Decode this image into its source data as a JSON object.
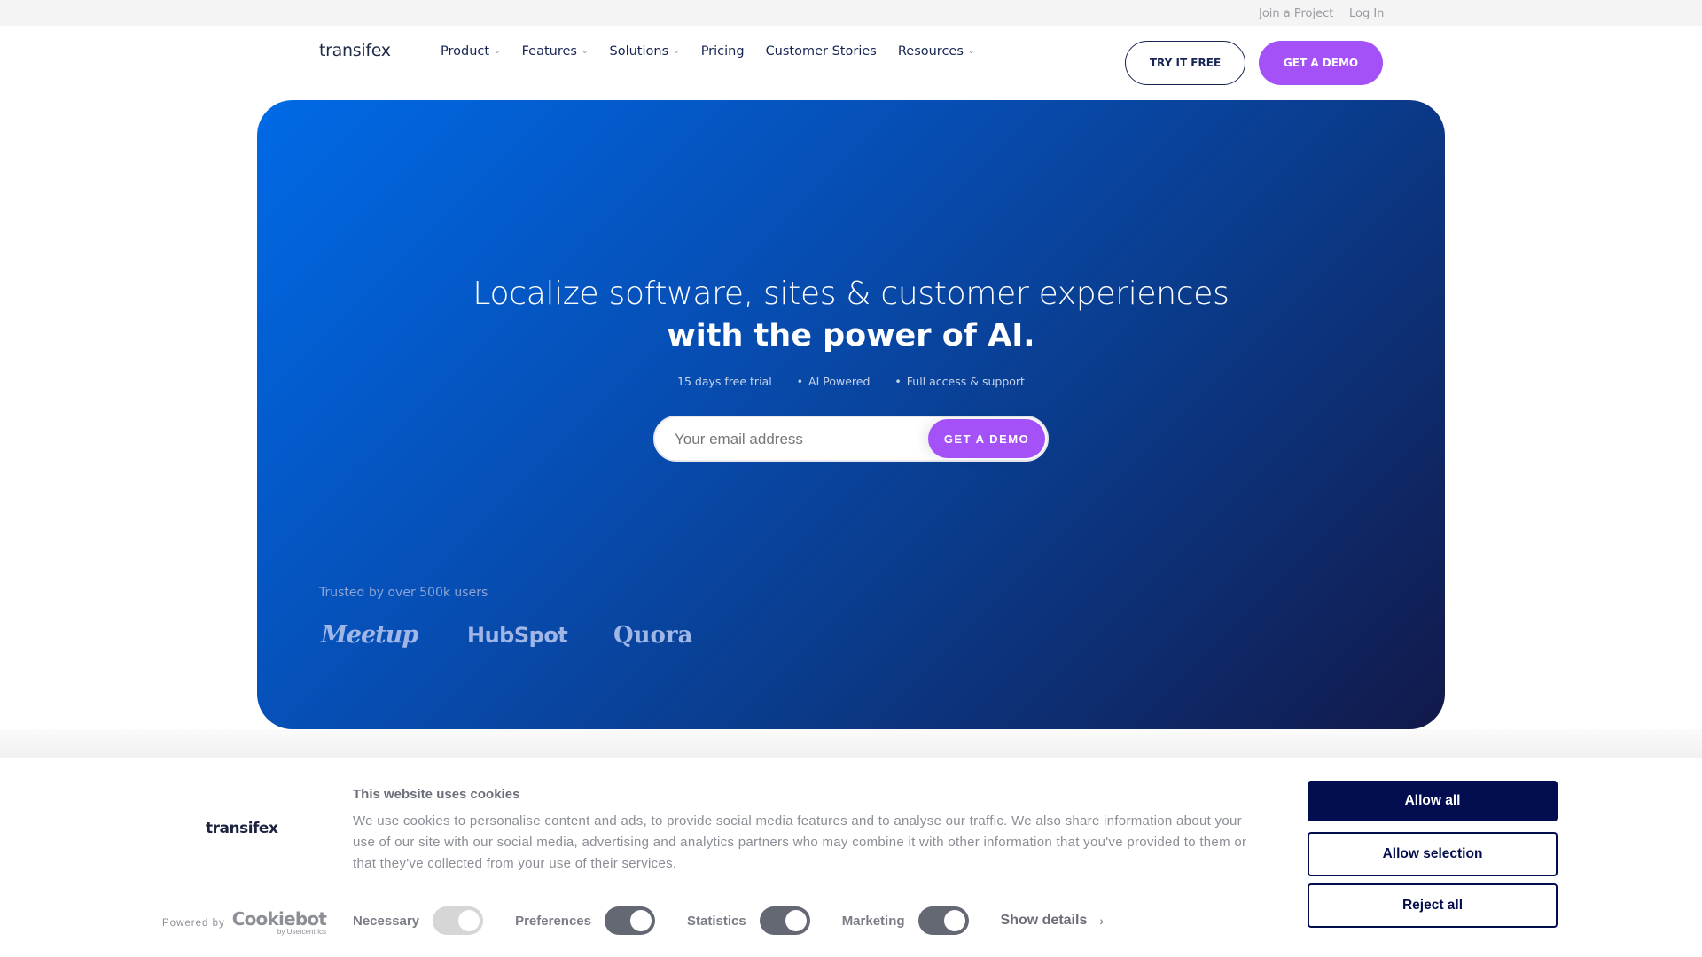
{
  "topbar": {
    "join_project": "Join a Project",
    "log_in": "Log In"
  },
  "nav": {
    "logo": "transifex",
    "items": [
      {
        "label": "Product",
        "has_dropdown": true
      },
      {
        "label": "Features",
        "has_dropdown": true
      },
      {
        "label": "Solutions",
        "has_dropdown": true
      },
      {
        "label": "Pricing",
        "has_dropdown": false
      },
      {
        "label": "Customer Stories",
        "has_dropdown": false
      },
      {
        "label": "Resources",
        "has_dropdown": true
      }
    ],
    "chevron": "⌄",
    "try_free": "TRY IT FREE",
    "get_demo": "GET A DEMO"
  },
  "hero": {
    "headline": "Localize software, sites & customer experiences",
    "headline_bold": "with the power of AI.",
    "bullets": [
      "15 days free trial",
      "AI Powered",
      "Full access & support"
    ],
    "bullet_dot": "•",
    "email_placeholder": "Your email address",
    "email_value": "",
    "cta": "GET A DEMO",
    "trusted": "Trusted by over 500k users",
    "customer_logos": [
      "Meetup",
      "HubSpot",
      "Quora"
    ]
  },
  "cookie": {
    "logo": "transifex",
    "powered_by": "Powered by",
    "cookiebot": "Cookiebot",
    "usercentrics": "by Usercentrics",
    "title": "This website uses cookies",
    "text": "We use cookies to personalise content and ads, to provide social media features and to analyse our traffic. We also share information about your use of our site with our social media, advertising and analytics partners who may combine it with other information that you've provided to them or that they've collected from your use of their services.",
    "toggles": [
      {
        "label": "Necessary",
        "on": true,
        "disabled": true
      },
      {
        "label": "Preferences",
        "on": true,
        "disabled": false
      },
      {
        "label": "Statistics",
        "on": true,
        "disabled": false
      },
      {
        "label": "Marketing",
        "on": true,
        "disabled": false
      }
    ],
    "show_details": "Show details",
    "show_details_arrow": "›",
    "allow_all": "Allow all",
    "allow_selection": "Allow selection",
    "reject_all": "Reject all"
  },
  "colors": {
    "accent_purple": "#a451f7",
    "navy": "#172554",
    "cookie_primary": "#020e4f",
    "hero_gradient_start": "#006ae6",
    "hero_gradient_end": "#12194a"
  }
}
